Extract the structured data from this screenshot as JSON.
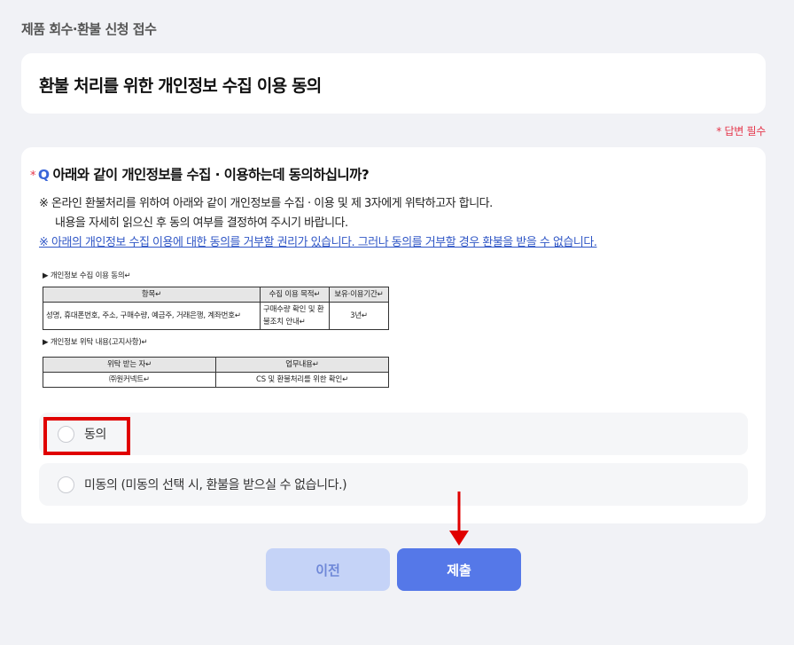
{
  "header": {
    "title": "제품 회수·환불 신청 접수"
  },
  "section": {
    "title": "환불 처리를 위한 개인정보 수집 이용 동의"
  },
  "required_note": "* 답변 필수",
  "question": {
    "star": "*",
    "prefix": "Q",
    "text": "아래와 같이 개인정보를 수집 ·  이용하는데 동의하십니까?",
    "desc_line1": "※ 온라인 환불처리를 위하여 아래와 같이 개인정보를 수집 · 이용 및 제 3자에게 위탁하고자 합니다.",
    "desc_line2": "내용을 자세히 읽으신 후 동의 여부를 결정하여 주시기 바랍니다.",
    "desc_link": "※ 아래의 개인정보 수집 이용에 대한 동의를 거부할 권리가 있습니다. 그러나 동의를 거부할 경우 환불을 받을 수 없습니다."
  },
  "doc": {
    "section1_label": "▶  개인정보 수집 이용 동의↵",
    "table1": {
      "headers": [
        "항목↵",
        "수집 이용 목적↵",
        "보유·이용기간↵"
      ],
      "row_item": "성명, 휴대폰번호, 주소, 구매수량, 예금주, 거래은행, 계좌번호↵",
      "row_purpose": "구매수량 확인 및 환불조치 안내↵",
      "row_period": "3년↵"
    },
    "section2_label": "▶  개인정보 위탁 내용(고지사항)↵",
    "table2": {
      "headers": [
        "위탁 받는 자↵",
        "업무내용↵"
      ],
      "row_trustee": "㈜원커넥트↵",
      "row_task": "CS 및 환불처리를 위한 확인↵"
    }
  },
  "options": [
    {
      "label": "동의",
      "selected": false
    },
    {
      "label": "미동의 (미동의 선택 시, 환불을 받으실 수 없습니다.)",
      "selected": false
    }
  ],
  "buttons": {
    "prev": "이전",
    "submit": "제출"
  },
  "colors": {
    "accent": "#5578e8",
    "required": "#e5364a",
    "annotation": "#e00000"
  }
}
